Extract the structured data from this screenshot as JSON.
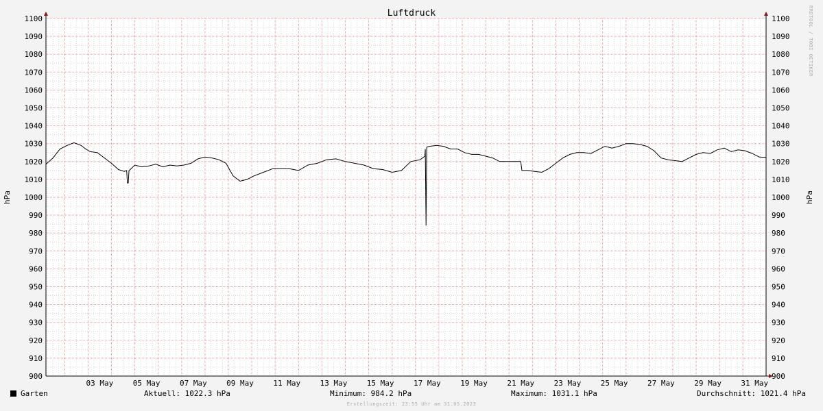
{
  "watermark": "RRDTOOL / TOBI OETIKER",
  "footer": "Erstellungszeit: 23:55 Uhr am 31.05.2023",
  "legend": {
    "series_name": "Garten",
    "current": "Aktuell: 1022.3 hPa",
    "minimum": "Minimum: 984.2 hPa",
    "maximum": "Maximum: 1031.1 hPa",
    "average": "Durchschnitt: 1021.4 hPa"
  },
  "colors": {
    "line": "#000000",
    "grid_major": "#f0a0a0",
    "grid_minor": "#d8d8d8",
    "plot_bg": "#ffffff",
    "page_bg": "#f3f3f3"
  },
  "chart_data": {
    "type": "line",
    "title": "Luftdruck",
    "ylabel_left": "hPa",
    "ylabel_right": "hPa",
    "ylim": [
      900,
      1100
    ],
    "ystep": 10,
    "xlim": [
      1.2,
      31.99
    ],
    "xticks": [
      {
        "day": 3,
        "label": "03 May"
      },
      {
        "day": 5,
        "label": "05 May"
      },
      {
        "day": 7,
        "label": "07 May"
      },
      {
        "day": 9,
        "label": "09 May"
      },
      {
        "day": 11,
        "label": "11 May"
      },
      {
        "day": 13,
        "label": "13 May"
      },
      {
        "day": 15,
        "label": "15 May"
      },
      {
        "day": 17,
        "label": "17 May"
      },
      {
        "day": 19,
        "label": "19 May"
      },
      {
        "day": 21,
        "label": "21 May"
      },
      {
        "day": 23,
        "label": "23 May"
      },
      {
        "day": 25,
        "label": "25 May"
      },
      {
        "day": 27,
        "label": "27 May"
      },
      {
        "day": 29,
        "label": "29 May"
      },
      {
        "day": 31,
        "label": "31 May"
      }
    ],
    "grid": true,
    "legend_position": "bottom",
    "series": [
      {
        "name": "Garten",
        "x": [
          1.2,
          1.5,
          1.8,
          2.1,
          2.4,
          2.7,
          2.9,
          3.1,
          3.4,
          3.7,
          4.0,
          4.3,
          4.55,
          4.65,
          4.68,
          4.72,
          4.75,
          4.8,
          5.0,
          5.3,
          5.6,
          5.9,
          6.2,
          6.5,
          6.8,
          7.1,
          7.4,
          7.7,
          8.0,
          8.3,
          8.6,
          8.9,
          9.2,
          9.5,
          9.8,
          10.1,
          10.5,
          10.9,
          11.2,
          11.6,
          12.0,
          12.4,
          12.8,
          13.2,
          13.6,
          14.0,
          14.4,
          14.8,
          15.2,
          15.6,
          16.0,
          16.4,
          16.8,
          17.2,
          17.4,
          17.42,
          17.45,
          17.48,
          17.6,
          17.9,
          18.2,
          18.5,
          18.8,
          19.1,
          19.4,
          19.7,
          20.0,
          20.3,
          20.6,
          20.9,
          21.2,
          21.5,
          21.55,
          21.8,
          22.1,
          22.4,
          22.7,
          23.0,
          23.3,
          23.6,
          23.9,
          24.2,
          24.5,
          24.8,
          25.1,
          25.4,
          25.7,
          26.0,
          26.3,
          26.6,
          26.9,
          27.2,
          27.5,
          27.8,
          28.1,
          28.4,
          28.7,
          29.0,
          29.3,
          29.6,
          29.9,
          30.2,
          30.5,
          30.8,
          31.1,
          31.4,
          31.7,
          31.99
        ],
        "y": [
          1018.5,
          1022,
          1027,
          1029,
          1030.5,
          1029,
          1027,
          1025.5,
          1025,
          1022,
          1019,
          1015.5,
          1014.5,
          1015,
          1008,
          1008,
          1015,
          1015.5,
          1018,
          1017,
          1017.5,
          1018.5,
          1017,
          1018,
          1017.5,
          1018,
          1019,
          1021.5,
          1022.5,
          1022,
          1021,
          1019,
          1012,
          1009,
          1010,
          1012,
          1014,
          1016,
          1016,
          1016,
          1015,
          1018,
          1019,
          1021,
          1021.5,
          1020,
          1019,
          1018,
          1016,
          1015.5,
          1014,
          1015,
          1020,
          1021,
          1023,
          1027,
          984.2,
          1028,
          1028.5,
          1029,
          1028.5,
          1027,
          1027,
          1025,
          1024,
          1024,
          1023,
          1022,
          1020,
          1020,
          1020,
          1020,
          1015,
          1015,
          1014.5,
          1014,
          1016,
          1019,
          1022,
          1024,
          1025,
          1025,
          1024.5,
          1026.5,
          1028.5,
          1027.5,
          1028.5,
          1030,
          1030,
          1029.5,
          1028.5,
          1026,
          1022,
          1021,
          1020.5,
          1020,
          1022,
          1024,
          1025,
          1024.5,
          1026.5,
          1027.5,
          1025.5,
          1026.5,
          1026,
          1024.5,
          1022.5,
          1022.3
        ]
      }
    ]
  }
}
